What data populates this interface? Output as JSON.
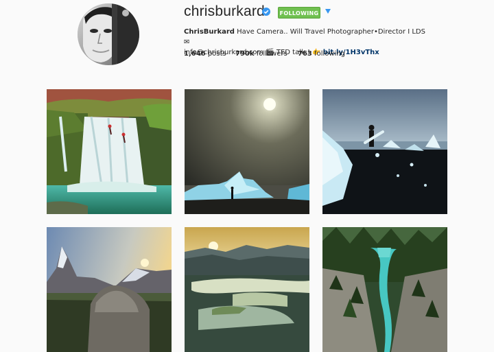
{
  "profile": {
    "username": "chrisburkard",
    "follow_label": "FOLLOWING",
    "bio_name": "ChrisBurkard",
    "bio_text_1": " Have Camera.. Will Travel Photographer•Director I LDS ✉",
    "bio_text_2": "info@chrisburkard.com 🎬 TED talk ! 👉 ",
    "bio_link": "bit.ly/1H3vThx",
    "stats": {
      "posts_count": "1,646",
      "posts_label": " posts",
      "followers_count": "790k",
      "followers_label": " followers",
      "following_count": "763",
      "following_label": " following"
    }
  },
  "colors": {
    "following_button": "#70c050",
    "verified_badge": "#3897f0",
    "link": "#003569",
    "background": "#fafafa"
  },
  "icons": {
    "verified": "verified-badge-icon",
    "dropdown": "chevron-down-icon"
  },
  "photos": [
    {
      "subject": "waterfall"
    },
    {
      "subject": "moon-iceberg"
    },
    {
      "subject": "surfer-iceberg"
    },
    {
      "subject": "matterhorn"
    },
    {
      "subject": "lake-sunset"
    },
    {
      "subject": "canyon-river"
    }
  ]
}
